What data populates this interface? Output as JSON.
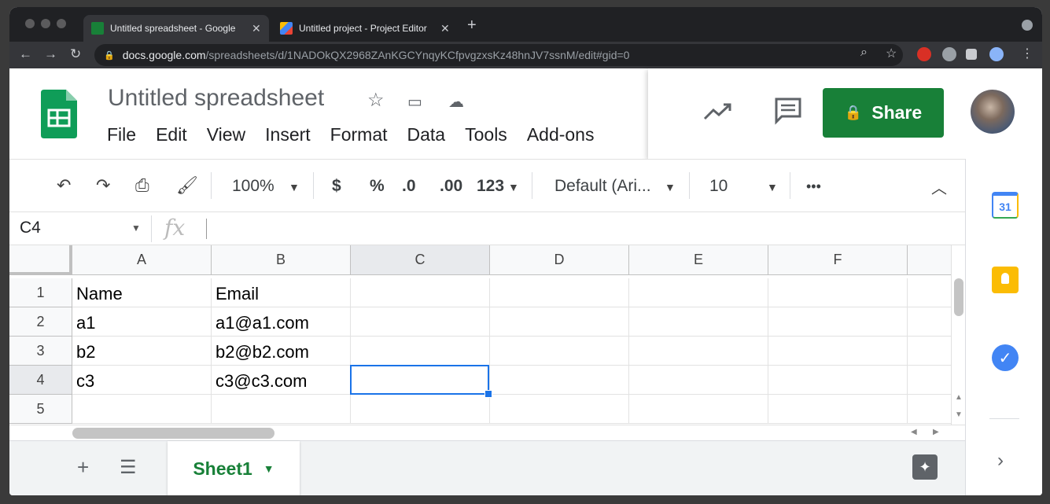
{
  "browser": {
    "tabs": [
      {
        "title": "Untitled spreadsheet - Google"
      },
      {
        "title": "Untitled project - Project Editor"
      }
    ],
    "url_host": "docs.google.com",
    "url_path": "/spreadsheets/d/1NADOkQX2968ZAnKGCYnqyKCfpvgzxsKz48hnJV7ssnM/edit#gid=0",
    "icons": {
      "close": "✕",
      "new_tab": "+",
      "back": "←",
      "forward": "→",
      "reload": "↻",
      "lock": "🔒",
      "zoom": "⌕",
      "star": "☆",
      "menu": "⋮"
    }
  },
  "docs": {
    "title": "Untitled spreadsheet",
    "menu": [
      "File",
      "Edit",
      "View",
      "Insert",
      "Format",
      "Data",
      "Tools",
      "Add-ons"
    ],
    "share_label": "Share",
    "brand_color": "#188038"
  },
  "toolbar": {
    "zoom": "100%",
    "currency": "$",
    "percent": "%",
    "dec_less": ".0",
    "dec_more": ".00",
    "number_format": "123",
    "font": "Default (Ari...",
    "font_size": "10",
    "more": "•••"
  },
  "formula_bar": {
    "namebox": "C4",
    "fx": "fx",
    "value": ""
  },
  "grid": {
    "columns": [
      "A",
      "B",
      "C",
      "D",
      "E",
      "F"
    ],
    "rows": [
      {
        "num": "1",
        "cells": [
          "Name",
          "Email",
          "",
          "",
          "",
          ""
        ]
      },
      {
        "num": "2",
        "cells": [
          "a1",
          "a1@a1.com",
          "",
          "",
          "",
          ""
        ]
      },
      {
        "num": "3",
        "cells": [
          "b2",
          "b2@b2.com",
          "",
          "",
          "",
          ""
        ]
      },
      {
        "num": "4",
        "cells": [
          "c3",
          "c3@c3.com",
          "",
          "",
          "",
          ""
        ]
      },
      {
        "num": "5",
        "cells": [
          "",
          "",
          "",
          "",
          "",
          ""
        ]
      }
    ],
    "selected_cell": "C4"
  },
  "sheets": {
    "active": "Sheet1"
  },
  "side_panel": {
    "calendar_day": "31"
  }
}
